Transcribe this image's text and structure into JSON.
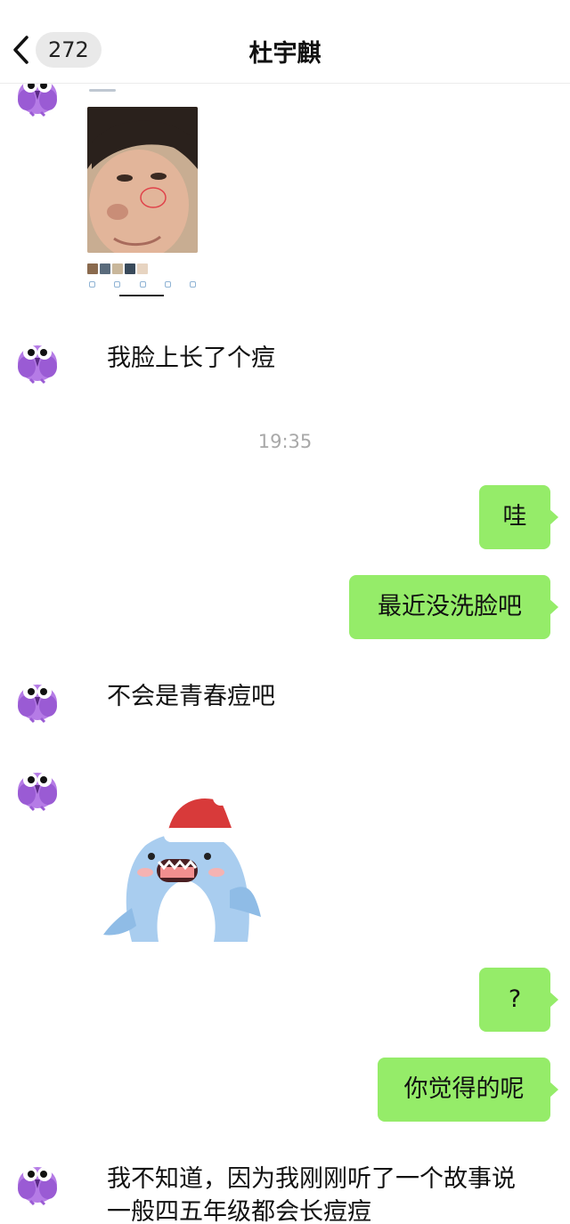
{
  "header": {
    "unread_count": "272",
    "contact_name": "杜宇麒",
    "back_icon": "chevron-left-icon"
  },
  "timestamp": "19:35",
  "messages": {
    "m1": "我脸上长了个痘",
    "m2": "哇",
    "m3": "最近没洗脸吧",
    "m4": "不会是青春痘吧",
    "m5": "?",
    "m6": "你觉得的呢",
    "m7": "我不知道，因为我刚刚听了一个故事说一般四五年级都会长痘痘"
  },
  "colors": {
    "outgoing_bubble": "#95ec69",
    "timestamp_text": "#a8a8a8",
    "avatar_bird": "#b57be6"
  },
  "icons": {
    "avatar": "purple-bird-avatar",
    "sticker": "shark-santa-hat-sticker"
  }
}
